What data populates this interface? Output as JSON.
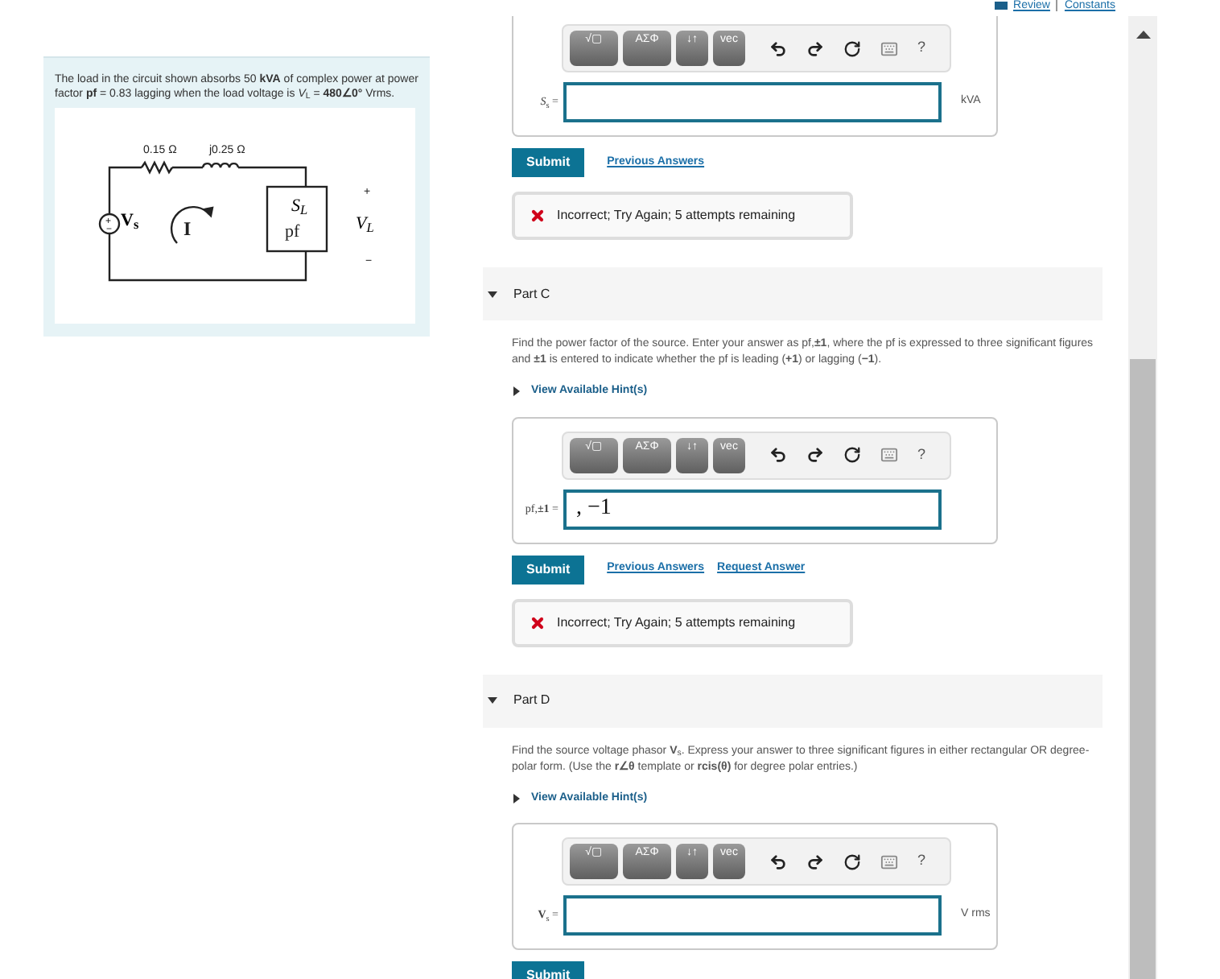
{
  "header_links": [
    {
      "label": "Review"
    },
    {
      "label": "Constants"
    }
  ],
  "problem": {
    "statement": "The load in the circuit shown absorbs 50 **kVA** of complex power at power factor **pf** = 0.83 lagging when the load voltage is *V*$_{L}$ = **480∠0°** Vrms.",
    "circuit": {
      "resistor": "0.15 Ω",
      "inductor": "j0.25 Ω",
      "source": "V$_{s}$",
      "current": "I",
      "load_power": "S$_{L}$",
      "load_pf": "pf",
      "load_voltage": "V$_{L}$",
      "plus": "+",
      "minus": "−"
    }
  },
  "parts": [
    {
      "kind": "continued",
      "toolbar": [
        "√▢",
        "ΑΣΦ",
        "↓↑",
        "vec"
      ],
      "help": "?",
      "answer_label": "*S*$_{s}$ =",
      "unit": "kVA",
      "submit": "Submit",
      "links": [
        "Previous Answers"
      ],
      "feedback": {
        "kind": "incorrect",
        "text": "Incorrect; Try Again; 5 attempts remaining"
      }
    },
    {
      "kind": "part",
      "title": "Part C",
      "expanded": true,
      "prompt": "Find the power factor of the source.  Enter your answer as pf,**±1**, where the pf is expressed to three significant figures and **±1** is entered to indicate whether the pf is leading (**+1**) or lagging (**−1**).",
      "hint": {
        "label": "View Available Hint(s)",
        "expanded": false
      },
      "toolbar": [
        "√▢",
        "ΑΣΦ",
        "↓↑",
        "vec"
      ],
      "help": "?",
      "answer_label": "pf,**±1** =",
      "answer_value": ", −1",
      "submit": "Submit",
      "links": [
        "Previous Answers",
        "Request Answer"
      ],
      "feedback": {
        "kind": "incorrect",
        "text": "Incorrect; Try Again; 5 attempts remaining"
      }
    },
    {
      "kind": "part",
      "title": "Part D",
      "expanded": true,
      "prompt": "Find the source voltage phasor **V**$_{s}$.  Express your answer to three significant figures in either rectangular OR degree-polar form.  (Use the **r∠θ** template or **rcis(θ)** for degree polar entries.)",
      "hint": {
        "label": "View Available Hint(s)",
        "expanded": false
      },
      "toolbar": [
        "√▢",
        "ΑΣΦ",
        "↓↑",
        "vec"
      ],
      "help": "?",
      "answer_label": "**V**$_{s}$ =",
      "unit": "V rms",
      "submit": "Submit"
    }
  ]
}
